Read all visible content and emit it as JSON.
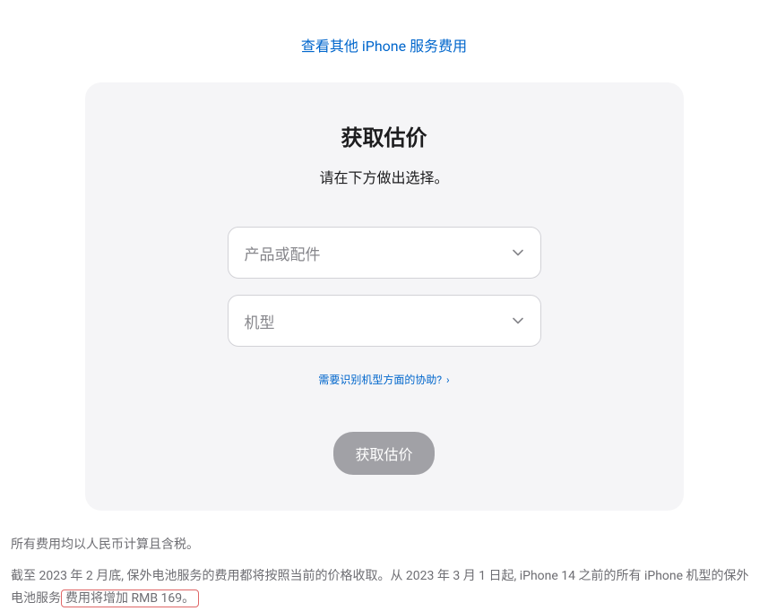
{
  "topLink": {
    "text": "查看其他 iPhone 服务费用"
  },
  "card": {
    "title": "获取估价",
    "subtitle": "请在下方做出选择。",
    "select1": {
      "placeholder": "产品或配件"
    },
    "select2": {
      "placeholder": "机型"
    },
    "helpLink": {
      "text": "需要识别机型方面的协助?",
      "arrow": "›"
    },
    "submitButton": {
      "label": "获取估价"
    }
  },
  "footer": {
    "line1": "所有费用均以人民币计算且含税。",
    "line2part1": "截至 2023 年 2 月底, 保外电池服务的费用都将按照当前的价格收取。从 2023 年 3 月 1 日起, iPhone 14 之前的所有 iPhone 机型的保外电池服务",
    "line2part2": "费用将增加 RMB 169。"
  }
}
